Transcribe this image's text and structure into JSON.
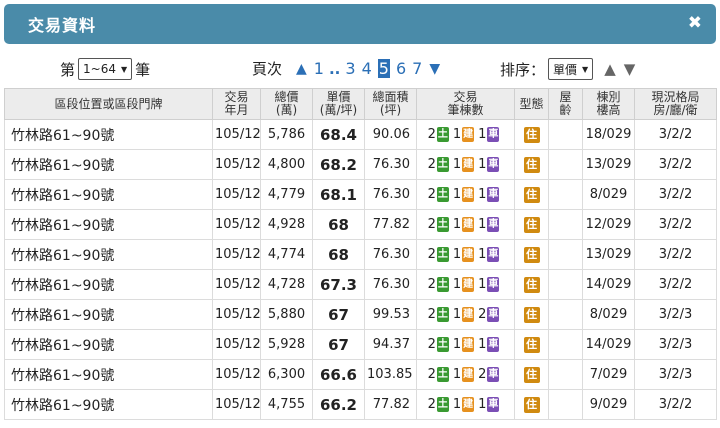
{
  "window": {
    "title": "交易資料",
    "close_glyph": "✖"
  },
  "controls": {
    "range": {
      "prefix": "第",
      "value": "1~64",
      "suffix": "筆"
    },
    "pager": {
      "label": "頁次",
      "pages_before": [
        "1"
      ],
      "dots": "..",
      "pages_after": [
        "3",
        "4"
      ],
      "current": "5",
      "pages_next": [
        "6",
        "7"
      ]
    },
    "sort": {
      "label": "排序：",
      "value": "單價"
    }
  },
  "table": {
    "headers": {
      "addr": "區段位置或區段門牌",
      "ym": [
        "交易",
        "年月"
      ],
      "total": [
        "總價",
        "(萬)"
      ],
      "unit": [
        "單價",
        "(萬/坪)"
      ],
      "area": [
        "總面積",
        "(坪)"
      ],
      "count": [
        "交易",
        "筆棟數"
      ],
      "type": "型態",
      "age": [
        "屋",
        "齡"
      ],
      "floor": [
        "棟別",
        "樓高"
      ],
      "layout": [
        "現況格局",
        "房/廳/衛"
      ]
    },
    "badges": {
      "land": "土",
      "bldg": "建",
      "park": "車"
    },
    "rows": [
      {
        "addr": "竹林路61~90號",
        "ym": "105/12",
        "total": "5,786",
        "unit": "68.4",
        "area": "90.06",
        "land": "2",
        "bldg": "1",
        "park": "1",
        "type": "住",
        "age": "",
        "floor": "18/029",
        "layout": "3/2/2"
      },
      {
        "addr": "竹林路61~90號",
        "ym": "105/12",
        "total": "4,800",
        "unit": "68.2",
        "area": "76.30",
        "land": "2",
        "bldg": "1",
        "park": "1",
        "type": "住",
        "age": "",
        "floor": "13/029",
        "layout": "3/2/2"
      },
      {
        "addr": "竹林路61~90號",
        "ym": "105/12",
        "total": "4,779",
        "unit": "68.1",
        "area": "76.30",
        "land": "2",
        "bldg": "1",
        "park": "1",
        "type": "住",
        "age": "",
        "floor": "8/029",
        "layout": "3/2/2"
      },
      {
        "addr": "竹林路61~90號",
        "ym": "105/12",
        "total": "4,928",
        "unit": "68",
        "area": "77.82",
        "land": "2",
        "bldg": "1",
        "park": "1",
        "type": "住",
        "age": "",
        "floor": "12/029",
        "layout": "3/2/2"
      },
      {
        "addr": "竹林路61~90號",
        "ym": "105/12",
        "total": "4,774",
        "unit": "68",
        "area": "76.30",
        "land": "2",
        "bldg": "1",
        "park": "1",
        "type": "住",
        "age": "",
        "floor": "13/029",
        "layout": "3/2/2"
      },
      {
        "addr": "竹林路61~90號",
        "ym": "105/12",
        "total": "4,728",
        "unit": "67.3",
        "area": "76.30",
        "land": "2",
        "bldg": "1",
        "park": "1",
        "type": "住",
        "age": "",
        "floor": "14/029",
        "layout": "3/2/2"
      },
      {
        "addr": "竹林路61~90號",
        "ym": "105/12",
        "total": "5,880",
        "unit": "67",
        "area": "99.53",
        "land": "2",
        "bldg": "1",
        "park": "2",
        "type": "住",
        "age": "",
        "floor": "8/029",
        "layout": "3/2/3"
      },
      {
        "addr": "竹林路61~90號",
        "ym": "105/12",
        "total": "5,928",
        "unit": "67",
        "area": "94.37",
        "land": "2",
        "bldg": "1",
        "park": "1",
        "type": "住",
        "age": "",
        "floor": "14/029",
        "layout": "3/2/3"
      },
      {
        "addr": "竹林路61~90號",
        "ym": "105/12",
        "total": "6,300",
        "unit": "66.6",
        "area": "103.85",
        "land": "2",
        "bldg": "1",
        "park": "2",
        "type": "住",
        "age": "",
        "floor": "7/029",
        "layout": "3/2/3"
      },
      {
        "addr": "竹林路61~90號",
        "ym": "105/12",
        "total": "4,755",
        "unit": "66.2",
        "area": "77.82",
        "land": "2",
        "bldg": "1",
        "park": "1",
        "type": "住",
        "age": "",
        "floor": "9/029",
        "layout": "3/2/2"
      }
    ]
  }
}
